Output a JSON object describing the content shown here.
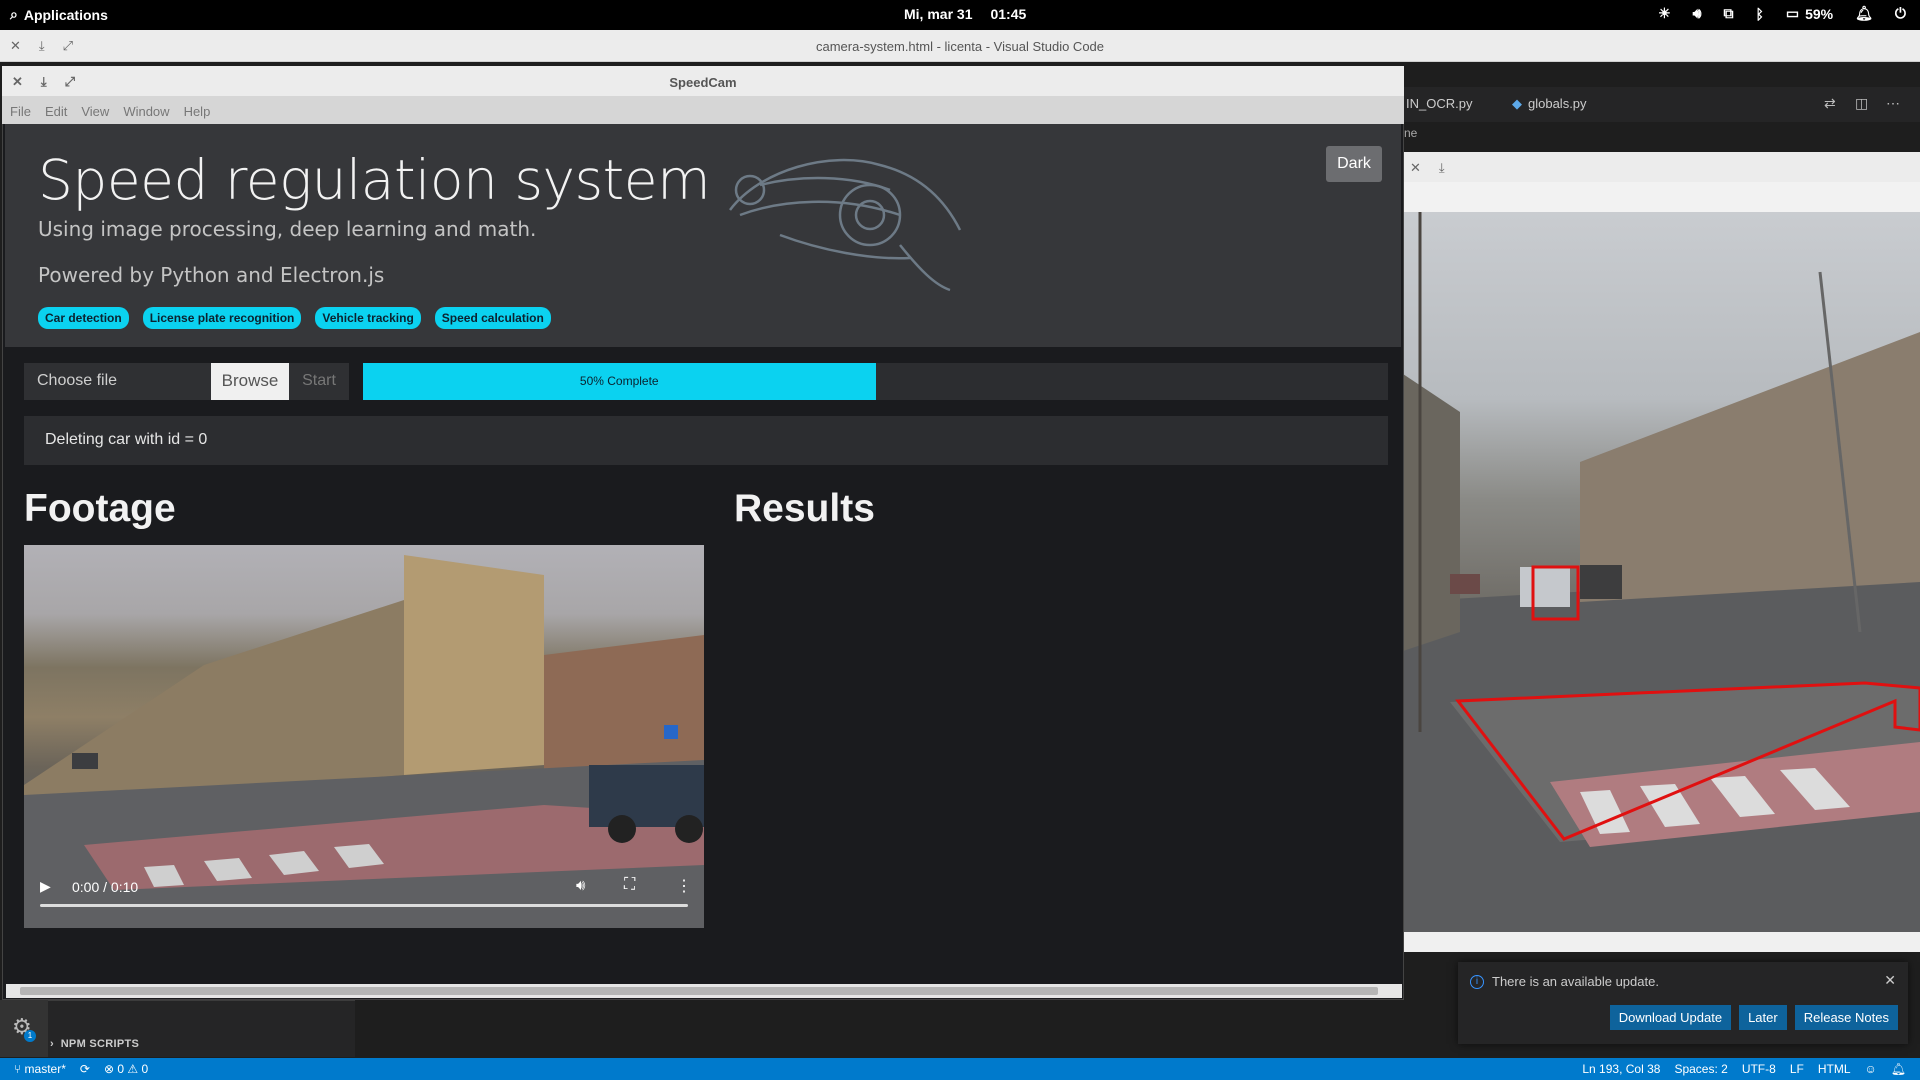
{
  "system": {
    "apps_label": "Applications",
    "date": "Mi, mar 31",
    "time": "01:45",
    "battery": "59%"
  },
  "vscode": {
    "window_title": "camera-system.html - licenta - Visual Studio Code",
    "tabs": [
      {
        "label": "IN_OCR.py"
      },
      {
        "label": "globals.py"
      }
    ],
    "breadcrumb": "ne",
    "sidebar_section": "NPM SCRIPTS",
    "status": {
      "branch": "master*",
      "problems": "0 ⚠ 0",
      "position": "Ln 193, Col 38",
      "spaces": "Spaces: 2",
      "encoding": "UTF-8",
      "eol": "LF",
      "language": "HTML"
    },
    "notification": {
      "message": "There is an available update.",
      "buttons": [
        "Download Update",
        "Later",
        "Release Notes"
      ]
    }
  },
  "speedcam": {
    "window_title": "SpeedCam",
    "menu": [
      "File",
      "Edit",
      "View",
      "Window",
      "Help"
    ],
    "hero": {
      "title": "Speed regulation system",
      "subtitle": "Using image processing, deep learning and math.",
      "powered": "Powered by Python and Electron.js",
      "badges": [
        "Car detection",
        "License plate recognition",
        "Vehicle tracking",
        "Speed calculation"
      ]
    },
    "theme_button": "Dark",
    "file_input": {
      "placeholder": "Choose file",
      "browse": "Browse",
      "start": "Start"
    },
    "progress": {
      "value_percent": 50,
      "label": "50% Complete"
    },
    "log_message": "Deleting car with id = 0",
    "footage_heading": "Footage",
    "results_heading": "Results",
    "video": {
      "time": "0:00 / 0:10"
    }
  },
  "colors": {
    "accent": "#0bd2f0",
    "vscode_blue": "#007acc",
    "detection_box": "#e01010"
  },
  "icons": [
    "search-icon",
    "brightness-icon",
    "volume-icon",
    "network-icon",
    "bluetooth-icon",
    "battery-icon",
    "notification-icon",
    "power-icon",
    "close-icon",
    "minimize-icon",
    "maximize-icon",
    "play-icon",
    "volume-icon",
    "fullscreen-icon",
    "more-icon",
    "gear-icon",
    "info-icon",
    "branch-icon",
    "sync-icon"
  ]
}
